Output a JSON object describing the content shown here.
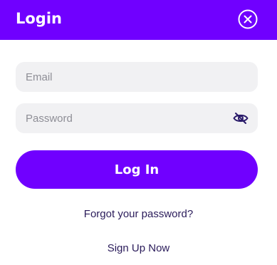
{
  "header": {
    "title": "Login",
    "close_icon": "close-circle-icon",
    "background_color": "#7000ff"
  },
  "form": {
    "email": {
      "placeholder": "Email",
      "value": ""
    },
    "password": {
      "placeholder": "Password",
      "value": "",
      "toggle_icon": "eye-slash-icon"
    },
    "submit_label": "Log In",
    "accent_color": "#7000ff"
  },
  "links": {
    "forgot_password": "Forgot your password?",
    "sign_up": "Sign Up Now"
  }
}
